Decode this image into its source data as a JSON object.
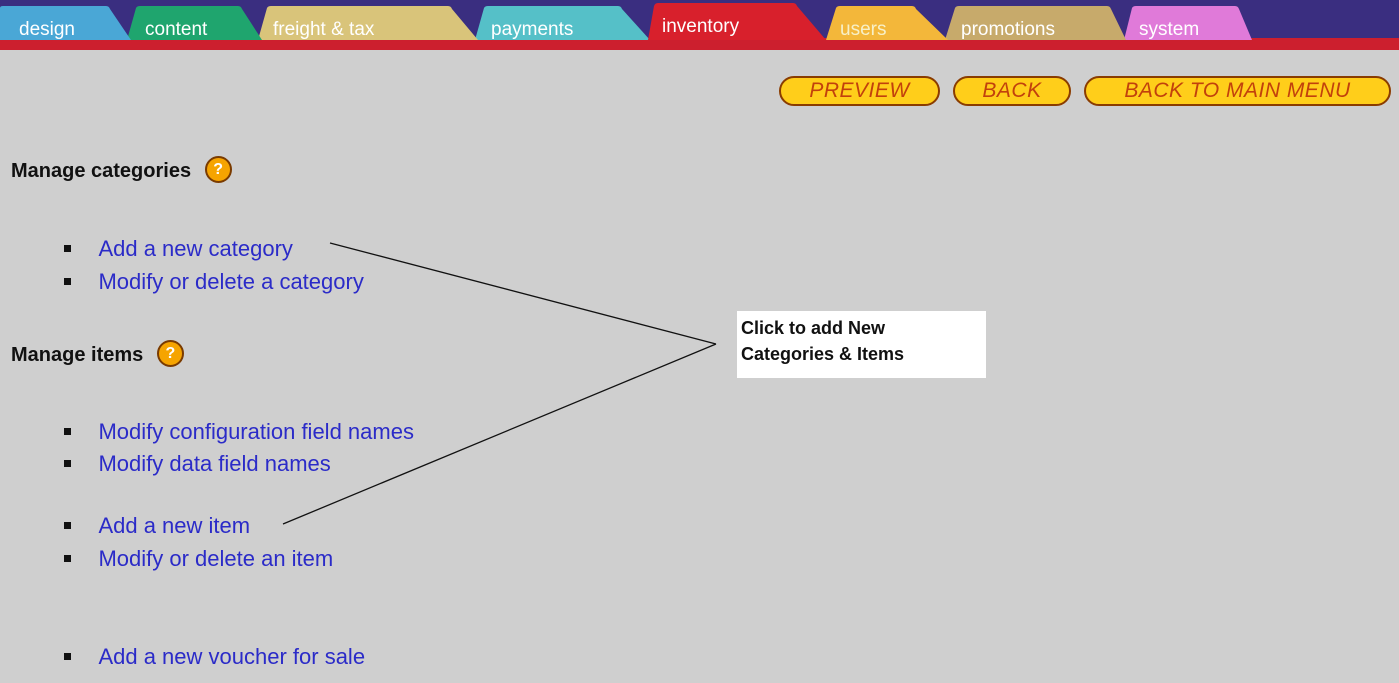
{
  "tabs": [
    {
      "label": "design",
      "color": "#4aa7d6",
      "active": false
    },
    {
      "label": "content",
      "color": "#1fa56e",
      "active": false
    },
    {
      "label": "freight & tax",
      "color": "#d9c47a",
      "active": false
    },
    {
      "label": "payments",
      "color": "#55c0c8",
      "active": false
    },
    {
      "label": "inventory",
      "color": "#d8202c",
      "active": true
    },
    {
      "label": "users",
      "color": "#f3b73a",
      "active": false
    },
    {
      "label": "promotions",
      "color": "#c7aa6b",
      "active": false
    },
    {
      "label": "system",
      "color": "#e07ad9",
      "active": false
    }
  ],
  "toolbar": {
    "preview_label": "PREVIEW",
    "back_label": "BACK",
    "back_main_label": "BACK TO MAIN MENU"
  },
  "categories": {
    "heading": "Manage categories",
    "help_glyph": "?",
    "links": [
      {
        "label": "Add a new category"
      },
      {
        "label": "Modify or delete a category"
      }
    ]
  },
  "items": {
    "heading": "Manage items",
    "help_glyph": "?",
    "links": [
      {
        "label": "Modify configuration field names"
      },
      {
        "label": "Modify data field names"
      },
      {
        "label": "Add a new item"
      },
      {
        "label": "Modify or delete an item"
      },
      {
        "label": "Add a new voucher for sale"
      }
    ]
  },
  "callout": {
    "line1": "Click to add New",
    "line2": "Categories & Items"
  },
  "colors": {
    "background": "#cfcfcf",
    "tabbar": "#3a2e80",
    "accent_red": "#cc1f2e",
    "link": "#2b2bc8",
    "pill_fill": "#ffce1a",
    "pill_text": "#c2410c",
    "help_icon": "#f6a400"
  }
}
